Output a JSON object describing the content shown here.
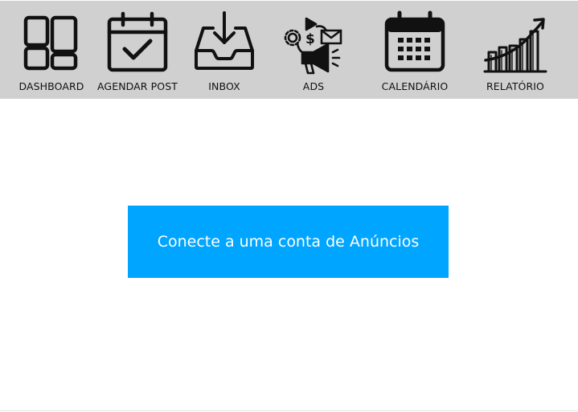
{
  "nav": {
    "items": [
      {
        "label": "DASHBOARD",
        "icon": "dashboard-grid-icon"
      },
      {
        "label": "AGENDAR POST",
        "icon": "calendar-check-icon"
      },
      {
        "label": "INBOX",
        "icon": "inbox-download-icon"
      },
      {
        "label": "ADS",
        "icon": "megaphone-ads-icon"
      },
      {
        "label": "CALENDÁRIO",
        "icon": "calendar-grid-icon"
      },
      {
        "label": "RELATÓRIO",
        "icon": "bar-chart-growth-icon"
      }
    ]
  },
  "main": {
    "connect_button_label": "Conecte a uma conta de Anúncios"
  },
  "colors": {
    "navbar_bg": "#d0d0d0",
    "button_bg": "#00a5ff",
    "button_text": "#ffffff",
    "icon_stroke": "#111111"
  }
}
